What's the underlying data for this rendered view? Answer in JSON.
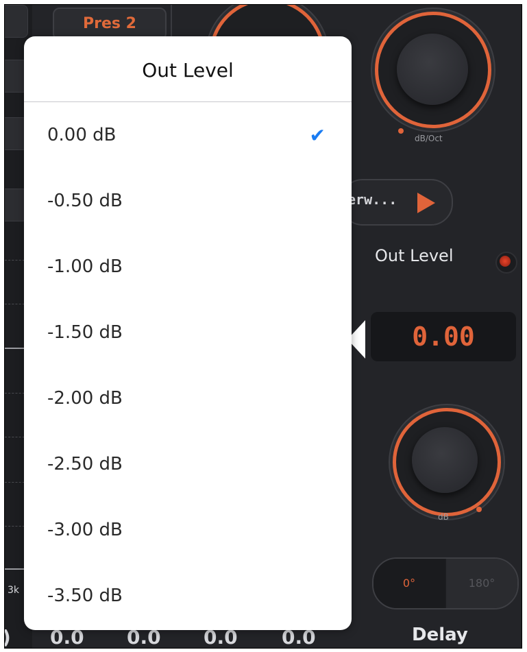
{
  "background": {
    "preset_label": "Pres 2",
    "top_knob_label": "dB/Oct",
    "type_button_label": "erw...",
    "out_level_label": "Out Level",
    "out_level_value": "0.00",
    "gain_knob_label": "dB",
    "phase_options": [
      "0°",
      "180°"
    ],
    "selected_phase": "0°",
    "delay_label": "Delay",
    "left_axis_label": "3k",
    "bottom_values": [
      ")",
      "0.0",
      "0.0",
      "0.0",
      "0.0"
    ],
    "accent_color": "#e0643a"
  },
  "popover": {
    "title": "Out Level",
    "selected_index": 0,
    "options": [
      {
        "label": "0.00 dB"
      },
      {
        "label": "-0.50 dB"
      },
      {
        "label": "-1.00 dB"
      },
      {
        "label": "-1.50 dB"
      },
      {
        "label": "-2.00 dB"
      },
      {
        "label": "-2.50 dB"
      },
      {
        "label": "-3.00 dB"
      },
      {
        "label": "-3.50 dB"
      }
    ],
    "check_icon": "checkmark-icon",
    "check_color": "#1a7cf2"
  }
}
